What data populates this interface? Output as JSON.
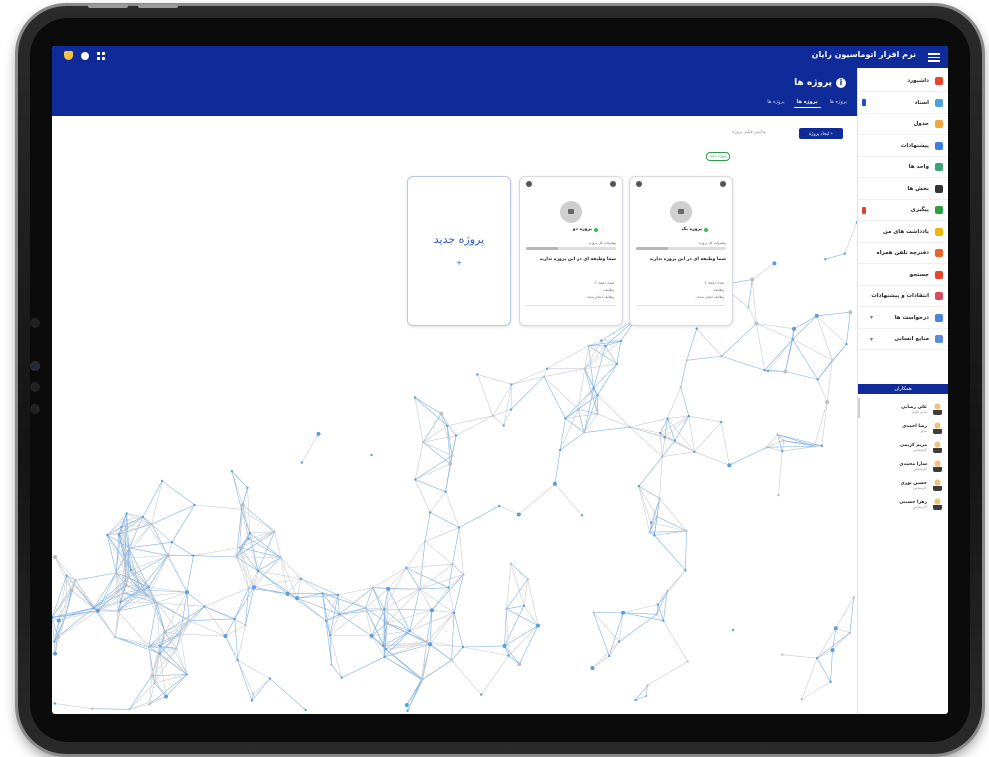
{
  "app": {
    "title": "نرم افزار اتوماسیون رایان"
  },
  "header": {
    "page_title": "پروژه ها",
    "tabs": [
      {
        "label": "پروژه ها",
        "active": false
      },
      {
        "label": "پروژه ها",
        "active": true
      },
      {
        "label": "پروژه ها",
        "active": false
      }
    ]
  },
  "sidebar": {
    "items": [
      {
        "label": "داشبورد",
        "icon": "home-icon",
        "color": "#e8452c"
      },
      {
        "label": "اسناد",
        "icon": "document-icon",
        "color": "#4aa3df",
        "mark": "#1b4fd6"
      },
      {
        "label": "جدول",
        "icon": "table-icon",
        "color": "#f2a93b"
      },
      {
        "label": "پیشنهادات",
        "icon": "diamond-icon",
        "color": "#3c7ee0"
      },
      {
        "label": "واحد ها",
        "icon": "org-chart-icon",
        "color": "#3aa37a"
      },
      {
        "label": "بخش ها",
        "icon": "qr-icon",
        "color": "#333333"
      },
      {
        "label": "پیگیری",
        "icon": "check-icon",
        "color": "#2f9e44",
        "mark": "#e0402f"
      },
      {
        "label": "یادداشت های من",
        "icon": "notes-icon",
        "color": "#f2b705"
      },
      {
        "label": "دفترچه تلفن همراه",
        "icon": "phonebook-icon",
        "color": "#e8652c"
      },
      {
        "label": "جستجو",
        "icon": "search-icon",
        "color": "#e8452c"
      },
      {
        "label": "انتقادات و پیشنهادات",
        "icon": "feedback-icon",
        "color": "#d94a63"
      },
      {
        "label": "درخواست ها",
        "icon": "request-icon",
        "color": "#4a86d9",
        "chevron": "▾"
      },
      {
        "label": "منابع انسانی",
        "icon": "people-icon",
        "color": "#5b8bd9",
        "chevron": "▾"
      }
    ],
    "section_title": "همکاران",
    "users": [
      {
        "name": "علی رضایی",
        "role": "مدیر عامل"
      },
      {
        "name": "رضا احمدی",
        "role": "مدیر"
      },
      {
        "name": "مریم کریمی",
        "role": "کارشناس"
      },
      {
        "name": "سارا محمدی",
        "role": "کارشناس"
      },
      {
        "name": "حسین نوری",
        "role": "کارشناس"
      },
      {
        "name": "زهرا حسینی",
        "role": "کارشناس"
      }
    ]
  },
  "toolbar": {
    "create_label": "ایجاد پروژه +",
    "filter_label": "نمایش فیلتر پروژه",
    "new_badge": "پروژه جدید"
  },
  "projects": [
    {
      "name": "پروژه یک",
      "progress_label": "پیشرفت کل پروژه",
      "progress": 0.35,
      "role": "شما وظیفه ای در این پروژه ندارید",
      "stats": [
        "تعداد اعضا: ۳",
        "وظایف: ۰",
        "وظایف انجام شده: ۰"
      ]
    },
    {
      "name": "پروژه دو",
      "progress_label": "پیشرفت کل پروژه",
      "progress": 0.35,
      "role": "شما وظیفه ای در این پروژه ندارید",
      "stats": [
        "تعداد اعضا: ۳",
        "وظایف: ۰",
        "وظایف انجام شده: ۰"
      ]
    }
  ],
  "new_project": {
    "title": "پروژه جدید",
    "plus": "+"
  },
  "colors": {
    "primary": "#0f2b9a",
    "accent": "#2a56c6",
    "status_active": "#2fbf4d"
  }
}
